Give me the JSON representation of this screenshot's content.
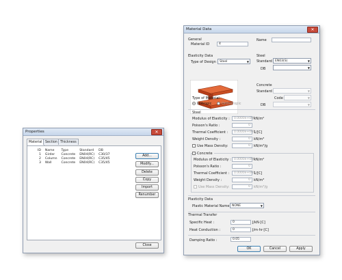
{
  "properties": {
    "title": "Properties",
    "tabs": [
      {
        "label": "Material"
      },
      {
        "label": "Section"
      },
      {
        "label": "Thickness"
      }
    ],
    "columns": [
      "ID",
      "Name",
      "Type",
      "Standard",
      "DB"
    ],
    "rows": [
      {
        "id": "1",
        "name": "Girder",
        "type": "Concrete",
        "standard": "EN04(RC)",
        "db": "C30/37"
      },
      {
        "id": "2",
        "name": "Column",
        "type": "Concrete",
        "standard": "EN04(RC)",
        "db": "C35/45"
      },
      {
        "id": "3",
        "name": "Wall",
        "type": "Concrete",
        "standard": "EN04(RC)",
        "db": "C35/45"
      }
    ],
    "buttons": {
      "add": "Add...",
      "modify": "Modify...",
      "delete": "Delete",
      "copy": "Copy",
      "import": "Import",
      "renumber": "Renumber"
    },
    "close": "Close"
  },
  "material": {
    "title": "Material Data",
    "general": "General",
    "material_id_label": "Material ID",
    "material_id": "4",
    "name_label": "Name",
    "name_value": "",
    "elasticity": "Elasticity Data",
    "type_of_design_label": "Type of Design",
    "type_of_design": "Steel",
    "steel_group": "Steel",
    "standard_label": "Standard",
    "steel_standard": "EN03(S)",
    "db_label": "DB",
    "steel_db": "",
    "concrete_group": "Concrete",
    "concrete_standard": "",
    "code_label": "Code",
    "concrete_code": "",
    "concrete_db": "",
    "type_of_material_label": "Type of Material",
    "isotropic": "Isotropic",
    "orthotropic": "Orthotropic",
    "steel_sub": "Steel",
    "steel_props": [
      {
        "label": "Modulus of Elasticity :",
        "value": "0.0000e+000",
        "unit": "kN/m²"
      },
      {
        "label": "Poisson's Ratio :",
        "value": "0",
        "unit": ""
      },
      {
        "label": "Thermal Coefficient :",
        "value": "0.0000e+000",
        "unit": "1/[C]"
      },
      {
        "label": "Weight Density :",
        "value": "0",
        "unit": "kN/m³"
      }
    ],
    "use_mass_density": "Use Mass Density:",
    "mass_value": "0",
    "mass_unit": "kN/m³/g",
    "concrete_sub": "Concrete",
    "concrete_props": [
      {
        "label": "Modulus of Elasticity :",
        "value": "0.0000e+000",
        "unit": "kN/m²"
      },
      {
        "label": "Poisson's Ratio :",
        "value": "0",
        "unit": ""
      },
      {
        "label": "Thermal Coefficient :",
        "value": "0.0000e+000",
        "unit": "1/[C]"
      },
      {
        "label": "Weight Density :",
        "value": "0",
        "unit": "kN/m³"
      }
    ],
    "concrete_mass_value": "0",
    "concrete_mass_unit": "kN/m³/g",
    "plasticity": "Plasticity Data",
    "plastic_material_label": "Plastic Material Name",
    "plastic_material": "NONE",
    "thermal_transfer": "Thermal Transfer",
    "specific_heat_label": "Specific Heat :",
    "specific_heat": "0",
    "specific_heat_unit": "J/kN·[C]",
    "heat_conduction_label": "Heat Conduction :",
    "heat_conduction": "0",
    "heat_conduction_unit": "J/m·hr·[C]",
    "damping_label": "Damping Ratio :",
    "damping": "0.05",
    "ok": "OK",
    "cancel": "Cancel",
    "apply": "Apply"
  }
}
